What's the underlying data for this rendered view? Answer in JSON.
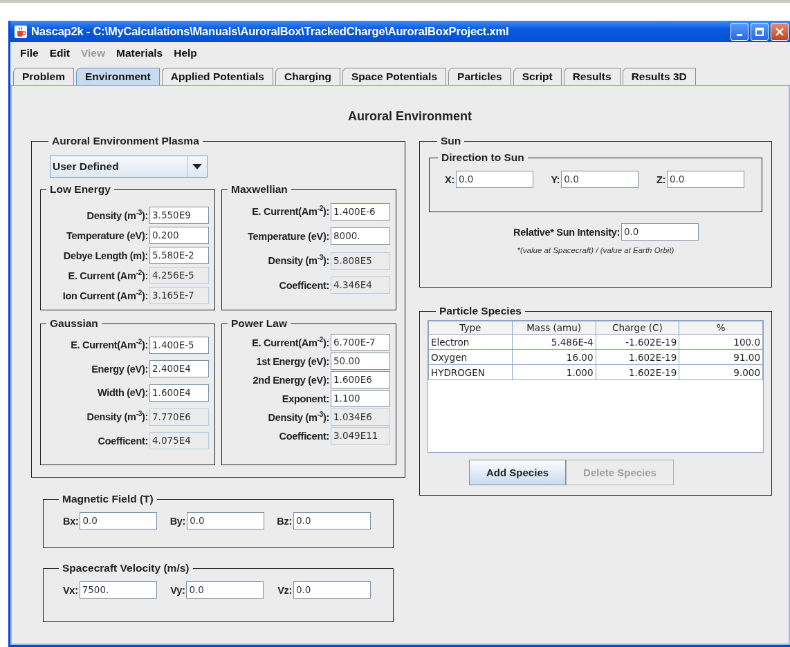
{
  "window": {
    "title": "Nascap2k - C:\\MyCalculations\\Manuals\\AuroralBox\\TrackedCharge\\AuroralBoxProject.xml"
  },
  "menu": [
    {
      "label": "File",
      "disabled": false
    },
    {
      "label": "Edit",
      "disabled": false
    },
    {
      "label": "View",
      "disabled": true
    },
    {
      "label": "Materials",
      "disabled": false
    },
    {
      "label": "Help",
      "disabled": false
    }
  ],
  "tabs": [
    {
      "label": "Problem",
      "selected": false
    },
    {
      "label": "Environment",
      "selected": true
    },
    {
      "label": "Applied Potentials",
      "selected": false
    },
    {
      "label": "Charging",
      "selected": false
    },
    {
      "label": "Space Potentials",
      "selected": false
    },
    {
      "label": "Particles",
      "selected": false
    },
    {
      "label": "Script",
      "selected": false
    },
    {
      "label": "Results",
      "selected": false
    },
    {
      "label": "Results 3D",
      "selected": false
    }
  ],
  "heading": "Auroral Environment",
  "plasma": {
    "title": "Auroral Environment Plasma",
    "dropdown": {
      "value": "User Defined"
    },
    "groups": [
      {
        "title": "Low Energy",
        "fields": [
          {
            "label": "Density (m$^{-3}$):",
            "value": "3.550E9",
            "readonly": false
          },
          {
            "label": "Temperature (eV):",
            "value": "0.200",
            "readonly": false
          },
          {
            "label": "Debye Length (m):",
            "value": "5.580E-2",
            "readonly": false
          },
          {
            "label": "E. Current (Am$^{-2}$):",
            "value": "4.256E-5",
            "readonly": true
          },
          {
            "label": "Ion Current (Am$^{-2}$):",
            "value": "3.165E-7",
            "readonly": true
          }
        ]
      },
      {
        "title": "Maxwellian",
        "fields": [
          {
            "label": "E. Current(Am$^{-2}$):",
            "value": "1.400E-6",
            "readonly": false
          },
          {
            "label": "Temperature (eV):",
            "value": "8000.",
            "readonly": false
          },
          {
            "label": "Density (m$^{-3}$):",
            "value": "5.808E5",
            "readonly": true
          },
          {
            "label": "Coefficent:",
            "value": "4.346E4",
            "readonly": true
          }
        ]
      },
      {
        "title": "Gaussian",
        "fields": [
          {
            "label": "E. Current(Am$^{-2}$):",
            "value": "1.400E-5",
            "readonly": false
          },
          {
            "label": "Energy (eV):",
            "value": "2.400E4",
            "readonly": false
          },
          {
            "label": "Width (eV):",
            "value": "1.600E4",
            "readonly": false
          },
          {
            "label": "Density (m$^{-3}$):",
            "value": "7.770E6",
            "readonly": true
          },
          {
            "label": "Coefficent:",
            "value": "4.075E4",
            "readonly": true
          }
        ]
      },
      {
        "title": "Power Law",
        "fields": [
          {
            "label": "E. Current(Am$^{-2}$):",
            "value": "6.700E-7",
            "readonly": false
          },
          {
            "label": "1st Energy (eV):",
            "value": "50.00",
            "readonly": false
          },
          {
            "label": "2nd Energy (eV):",
            "value": "1.600E6",
            "readonly": false
          },
          {
            "label": "Exponent:",
            "value": "1.100",
            "readonly": false
          },
          {
            "label": "Density (m$^{-3}$):",
            "value": "1.034E6",
            "readonly": true
          },
          {
            "label": "Coefficent:",
            "value": "3.049E11",
            "readonly": true
          }
        ]
      }
    ]
  },
  "magnetic_field": {
    "title": "Magnetic Field (T)",
    "fields": [
      {
        "label": "Bx:",
        "value": "0.0"
      },
      {
        "label": "By:",
        "value": "0.0"
      },
      {
        "label": "Bz:",
        "value": "0.0"
      }
    ]
  },
  "velocity": {
    "title": "Spacecraft Velocity (m/s)",
    "fields": [
      {
        "label": "Vx:",
        "value": "7500."
      },
      {
        "label": "Vy:",
        "value": "0.0"
      },
      {
        "label": "Vz:",
        "value": "0.0"
      }
    ]
  },
  "sun": {
    "title": "Sun",
    "direction": {
      "title": "Direction to Sun",
      "fields": [
        {
          "label": "X:",
          "value": "0.0"
        },
        {
          "label": "Y:",
          "value": "0.0"
        },
        {
          "label": "Z:",
          "value": "0.0"
        }
      ]
    },
    "intensity": {
      "label": "Relative* Sun Intensity:",
      "value": "0.0"
    },
    "note": "*(value at Spacecraft) / (value at Earth Orbit)"
  },
  "species": {
    "title": "Particle Species",
    "columns": [
      "Type",
      "Mass (amu)",
      "Charge (C)",
      "%"
    ],
    "rows": [
      [
        "Electron",
        "5.486E-4",
        "-1.602E-19",
        "100.0"
      ],
      [
        "Oxygen",
        "16.00",
        "1.602E-19",
        "91.00"
      ],
      [
        "HYDROGEN",
        "1.000",
        "1.602E-19",
        "9.000"
      ]
    ],
    "buttons": [
      {
        "label": "Add Species",
        "disabled": false
      },
      {
        "label": "Delete Species",
        "disabled": true
      }
    ]
  }
}
